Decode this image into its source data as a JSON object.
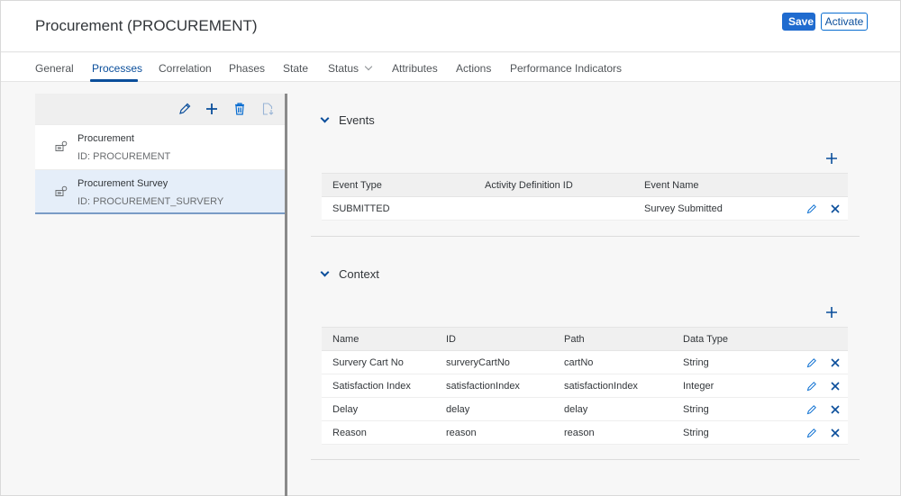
{
  "header": {
    "title": "Procurement (PROCUREMENT)",
    "save_label": "Save",
    "activate_label": "Activate"
  },
  "tabs": [
    {
      "label": "General",
      "active": false
    },
    {
      "label": "Processes",
      "active": true
    },
    {
      "label": "Correlation",
      "active": false
    },
    {
      "label": "Phases",
      "active": false
    },
    {
      "label": "State",
      "active": false
    },
    {
      "label": "Status",
      "active": false,
      "has_dropdown": true
    },
    {
      "label": "Attributes",
      "active": false
    },
    {
      "label": "Actions",
      "active": false
    },
    {
      "label": "Performance Indicators",
      "active": false
    }
  ],
  "left_panel": {
    "toolbar_icons": [
      "edit-icon",
      "add-icon",
      "delete-icon",
      "import-icon"
    ],
    "items": [
      {
        "title": "Procurement",
        "id_text": "ID: PROCUREMENT",
        "selected": false,
        "icon": "process-icon"
      },
      {
        "title": "Procurement Survey",
        "id_text": "ID: PROCUREMENT_SURVERY",
        "selected": true,
        "icon": "process-icon"
      }
    ]
  },
  "events": {
    "title": "Events",
    "columns": [
      "Event Type",
      "Activity Definition ID",
      "Event Name"
    ],
    "rows": [
      {
        "event_type": "SUBMITTED",
        "activity_definition_id": "",
        "event_name": "Survey Submitted"
      }
    ]
  },
  "context": {
    "title": "Context",
    "columns": [
      "Name",
      "ID",
      "Path",
      "Data Type"
    ],
    "rows": [
      {
        "name": "Survery Cart No",
        "id": "surveryCartNo",
        "path": "cartNo",
        "data_type": "String"
      },
      {
        "name": "Satisfaction Index",
        "id": "satisfactionIndex",
        "path": "satisfactionIndex",
        "data_type": "Integer"
      },
      {
        "name": "Delay",
        "id": "delay",
        "path": "delay",
        "data_type": "String"
      },
      {
        "name": "Reason",
        "id": "reason",
        "path": "reason",
        "data_type": "String"
      }
    ]
  },
  "colors": {
    "accent": "#0a4e9b",
    "primary_button": "#1f6bcf",
    "selected_item_bg": "#e5eef9"
  }
}
